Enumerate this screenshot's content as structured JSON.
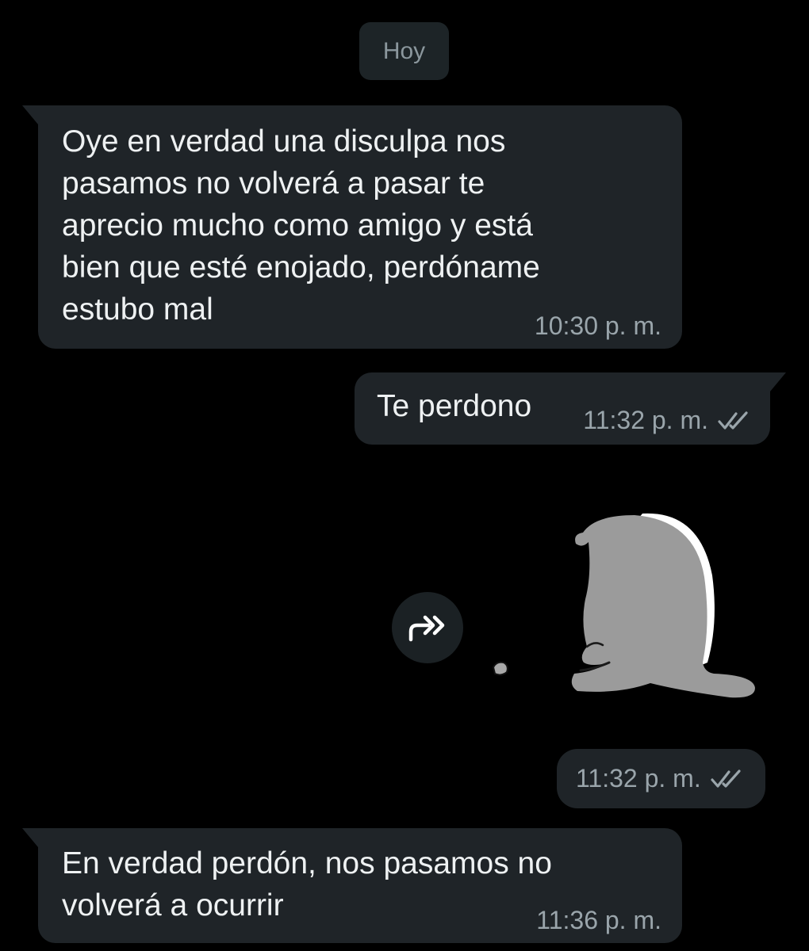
{
  "chat": {
    "date_label": "Hoy",
    "messages": [
      {
        "direction": "incoming",
        "text": "Oye en verdad una disculpa nos\npasamos no volverá a pasar te\naprecio mucho como amigo y está\nbien que esté enojado, perdóname\nestubo mal",
        "time": "10:30 p. m."
      },
      {
        "direction": "outgoing",
        "text": "Te perdono",
        "time": "11:32 p. m.",
        "status": "read"
      },
      {
        "direction": "outgoing",
        "type": "sticker",
        "sticker": "sad-cat-sitting-sticker",
        "time": "11:32 p. m.",
        "status": "read"
      },
      {
        "direction": "incoming",
        "text": "En verdad perdón, nos pasamos no\nvolverá a ocurrir",
        "time": "11:36 p. m."
      }
    ]
  },
  "icons": {
    "forward": "forward-arrow-icon",
    "read_receipt": "double-check-icon"
  },
  "colors": {
    "background": "#000000",
    "bubble": "#1f2428",
    "date_chip": "#1d2427",
    "text": "#eef1f2",
    "meta_text": "#9aa5ab",
    "sticker_fill": "#9b9b9b"
  }
}
